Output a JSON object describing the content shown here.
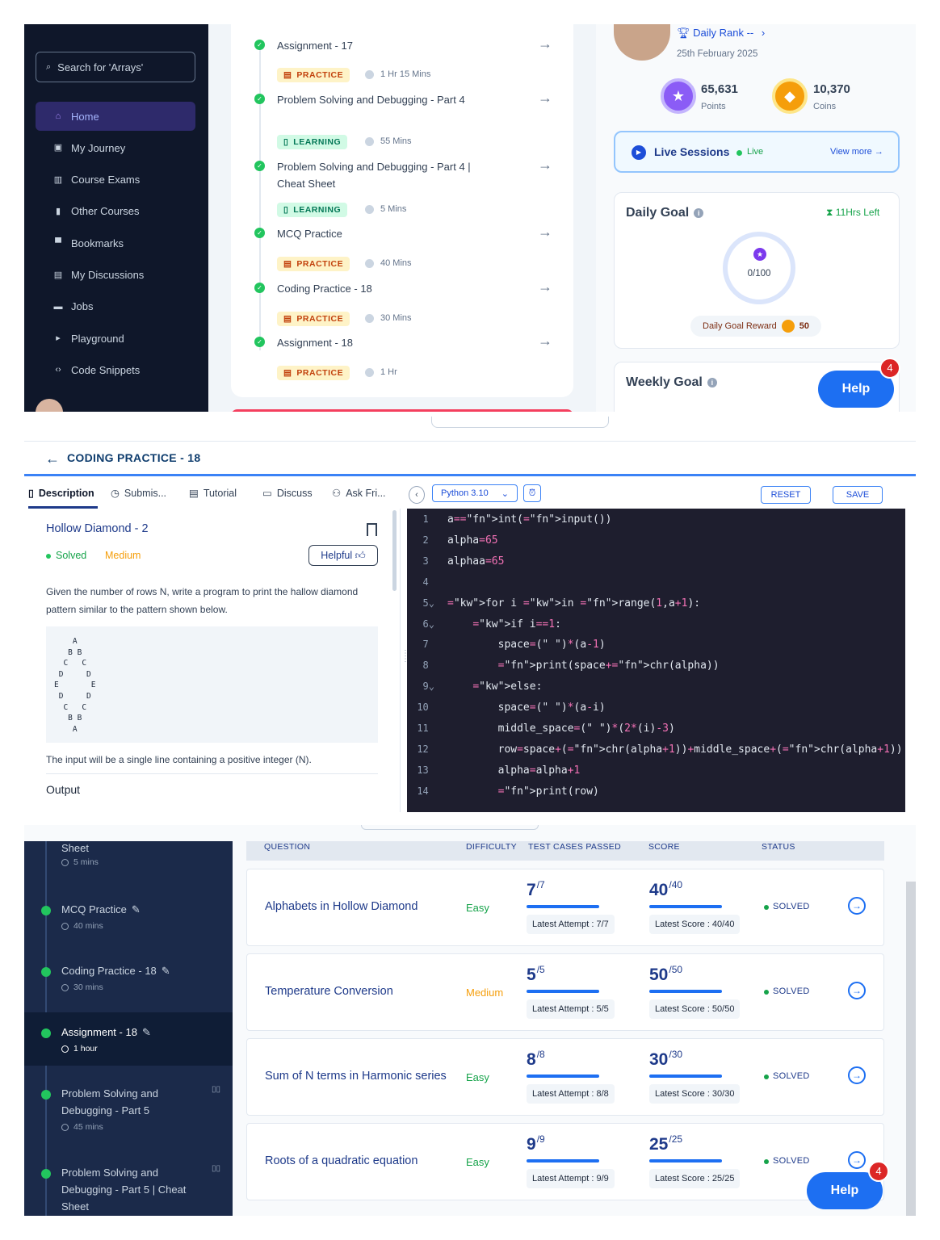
{
  "panel1": {
    "search_placeholder": "Search for 'Arrays'",
    "sidebar": [
      {
        "label": "Home",
        "icon": "home-icon",
        "active": true
      },
      {
        "label": "My Journey",
        "icon": "journey-icon"
      },
      {
        "label": "Course Exams",
        "icon": "exams-icon"
      },
      {
        "label": "Other Courses",
        "icon": "courses-icon"
      },
      {
        "label": "Bookmarks",
        "icon": "bookmark-icon"
      },
      {
        "label": "My Discussions",
        "icon": "discussions-icon"
      },
      {
        "label": "Jobs",
        "icon": "jobs-icon"
      },
      {
        "label": "Playground",
        "icon": "terminal-icon"
      },
      {
        "label": "Code Snippets",
        "icon": "code-icon"
      }
    ],
    "timeline": [
      {
        "title": "Assignment - 17",
        "type": "PRACTICE",
        "duration": "1 Hr 15 Mins"
      },
      {
        "title": "Problem Solving and Debugging - Part 4",
        "type": "LEARNING",
        "duration": "55 Mins"
      },
      {
        "title": "Problem Solving and Debugging - Part 4 | Cheat Sheet",
        "type": "LEARNING",
        "duration": "5 Mins"
      },
      {
        "title": "MCQ Practice",
        "type": "PRACTICE",
        "duration": "40 Mins"
      },
      {
        "title": "Coding Practice - 18",
        "type": "PRACTICE",
        "duration": "30 Mins"
      },
      {
        "title": "Assignment - 18",
        "type": "PRACTICE",
        "duration": "1 Hr"
      }
    ],
    "rank": "Daily Rank --",
    "date": "25th February 2025",
    "points_value": "65,631",
    "points_label": "Points",
    "coins_value": "10,370",
    "coins_label": "Coins",
    "live_title": "Live Sessions",
    "live_tag": "Live",
    "live_more": "View more →",
    "goal_title": "Daily Goal",
    "goal_left": "11Hrs Left",
    "goal_value": "0/100",
    "goal_progress": 0,
    "reward_label": "Daily Goal Reward",
    "reward_value": "50",
    "weekly_title": "Weekly Goal",
    "help_label": "Help",
    "help_badge": "4"
  },
  "panel2": {
    "title": "CODING PRACTICE - 18",
    "tabs": [
      "Description",
      "Submis...",
      "Tutorial",
      "Discuss",
      "Ask Fri..."
    ],
    "language": "Python 3.10",
    "reset": "RESET",
    "save": "SAVE",
    "question_title": "Hollow Diamond - 2",
    "status": "Solved",
    "difficulty": "Medium",
    "helpful": "Helpful",
    "question_text": "Given the number of rows N, write a program to print the hallow diamond pattern similar to the pattern shown below.",
    "pattern": "    A\n   B B\n  C   C\n D     D\nE       E\n D     D\n  C   C\n   B B\n    A",
    "input_text": "The input will be a single line containing a positive integer (N).",
    "output_heading": "Output",
    "code_lines": [
      "a=int(input())",
      "alpha=65",
      "alphaa=65",
      "",
      "for i in range(1,a+1):",
      "    if i==1:",
      "        space=(\" \")*(a-1)",
      "        print(space+chr(alpha))",
      "    else:",
      "        space=(\" \")*(a-i)",
      "        middle_space=(\" \")*(2*(i)-3)",
      "        row=space+(chr(alpha+1))+middle_space+(chr(alpha+1))",
      "        alpha=alpha+1",
      "        print(row)"
    ]
  },
  "panel3": {
    "sidebar": [
      {
        "title": "Sheet",
        "duration": "5 mins",
        "done": false,
        "book": false,
        "pen": false
      },
      {
        "title": "MCQ Practice",
        "duration": "40 mins",
        "done": true,
        "book": false,
        "pen": true
      },
      {
        "title": "Coding Practice - 18",
        "duration": "30 mins",
        "done": true,
        "book": false,
        "pen": true
      },
      {
        "title": "Assignment - 18",
        "duration": "1 hour",
        "done": true,
        "book": false,
        "pen": true,
        "active": true
      },
      {
        "title": "Problem Solving and Debugging - Part 5",
        "duration": "45 mins",
        "done": true,
        "book": true,
        "pen": false
      },
      {
        "title": "Problem Solving and Debugging - Part 5 | Cheat Sheet",
        "duration": "",
        "done": true,
        "book": true,
        "pen": false
      }
    ],
    "headers": [
      "QUESTION",
      "DIFFICULTY",
      "TEST CASES PASSED",
      "SCORE",
      "STATUS"
    ],
    "rows": [
      {
        "name": "Alphabets in Hollow Diamond",
        "difficulty": "Easy",
        "passed": "7",
        "total": "7",
        "attempt": "Latest Attempt : 7/7",
        "score": "40",
        "max": "40",
        "latest": "Latest Score : 40/40",
        "status": "SOLVED"
      },
      {
        "name": "Temperature Conversion",
        "difficulty": "Medium",
        "passed": "5",
        "total": "5",
        "attempt": "Latest Attempt : 5/5",
        "score": "50",
        "max": "50",
        "latest": "Latest Score : 50/50",
        "status": "SOLVED"
      },
      {
        "name": "Sum of N terms in Harmonic series",
        "difficulty": "Easy",
        "passed": "8",
        "total": "8",
        "attempt": "Latest Attempt : 8/8",
        "score": "30",
        "max": "30",
        "latest": "Latest Score : 30/30",
        "status": "SOLVED"
      },
      {
        "name": "Roots of a quadratic equation",
        "difficulty": "Easy",
        "passed": "9",
        "total": "9",
        "attempt": "Latest Attempt : 9/9",
        "score": "25",
        "max": "25",
        "latest": "Latest Score : 25/25",
        "status": "SOLVED"
      }
    ],
    "help_label": "Help",
    "help_badge": "4"
  },
  "colors": {
    "easy": "#16a34a",
    "medium": "#f59e0b",
    "accent": "#1d6ff2"
  }
}
